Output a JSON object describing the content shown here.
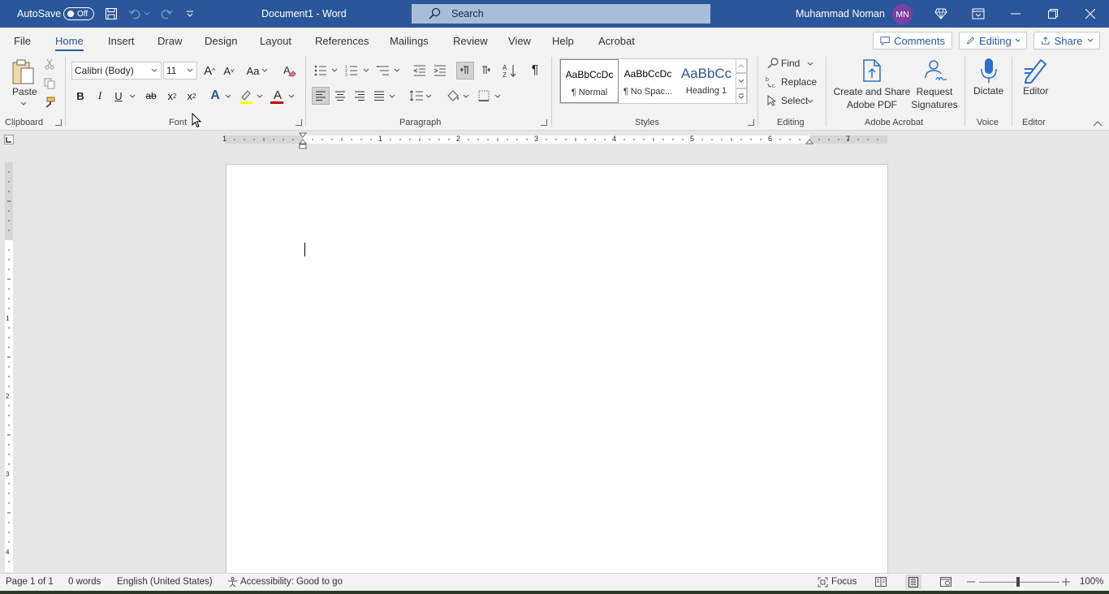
{
  "titlebar": {
    "autosave_label": "AutoSave",
    "autosave_state": "Off",
    "document_title": "Document1  -  Word",
    "search_placeholder": "Search",
    "user_name": "Muhammad Noman",
    "user_initials": "MN"
  },
  "tabs": [
    "File",
    "Home",
    "Insert",
    "Draw",
    "Design",
    "Layout",
    "References",
    "Mailings",
    "Review",
    "View",
    "Help",
    "Acrobat"
  ],
  "active_tab": "Home",
  "header_buttons": {
    "comments": "Comments",
    "editing": "Editing",
    "share": "Share"
  },
  "clipboard": {
    "paste_label": "Paste",
    "group_label": "Clipboard"
  },
  "font": {
    "font_name": "Calibri (Body)",
    "font_size": "11",
    "case_label": "Aa",
    "group_label": "Font",
    "bold": "B",
    "italic": "I",
    "underline": "U",
    "strike": "ab",
    "subscript": "x",
    "superscript": "x",
    "text_effects": "A",
    "font_color": "A",
    "highlight_color": "#ffff00",
    "font_color_hex": "#c00000"
  },
  "paragraph": {
    "group_label": "Paragraph"
  },
  "styles": {
    "group_label": "Styles",
    "items": [
      {
        "sample": "AaBbCcDc",
        "name": "¶ Normal"
      },
      {
        "sample": "AaBbCcDc",
        "name": "¶ No Spac..."
      },
      {
        "sample": "AaBbCc",
        "name": "Heading 1"
      }
    ]
  },
  "editing": {
    "find": "Find",
    "replace": "Replace",
    "select": "Select",
    "group_label": "Editing"
  },
  "acrobat": {
    "create_share_1": "Create and Share",
    "create_share_2": "Adobe PDF",
    "request_1": "Request",
    "request_2": "Signatures",
    "group_label": "Adobe Acrobat"
  },
  "voice": {
    "dictate": "Dictate",
    "group_label": "Voice"
  },
  "editor": {
    "editor": "Editor",
    "group_label": "Editor"
  },
  "ruler_numbers": [
    "1",
    "1",
    "2",
    "3",
    "4",
    "5",
    "6",
    "7"
  ],
  "vruler_numbers": [
    "1",
    "2",
    "3",
    "4"
  ],
  "status": {
    "page": "Page 1 of 1",
    "words": "0 words",
    "language": "English (United States)",
    "accessibility": "Accessibility: Good to go",
    "focus": "Focus",
    "zoom": "100%"
  },
  "colors": {
    "accent": "#2b579a",
    "avatar": "#7e3fa3"
  }
}
